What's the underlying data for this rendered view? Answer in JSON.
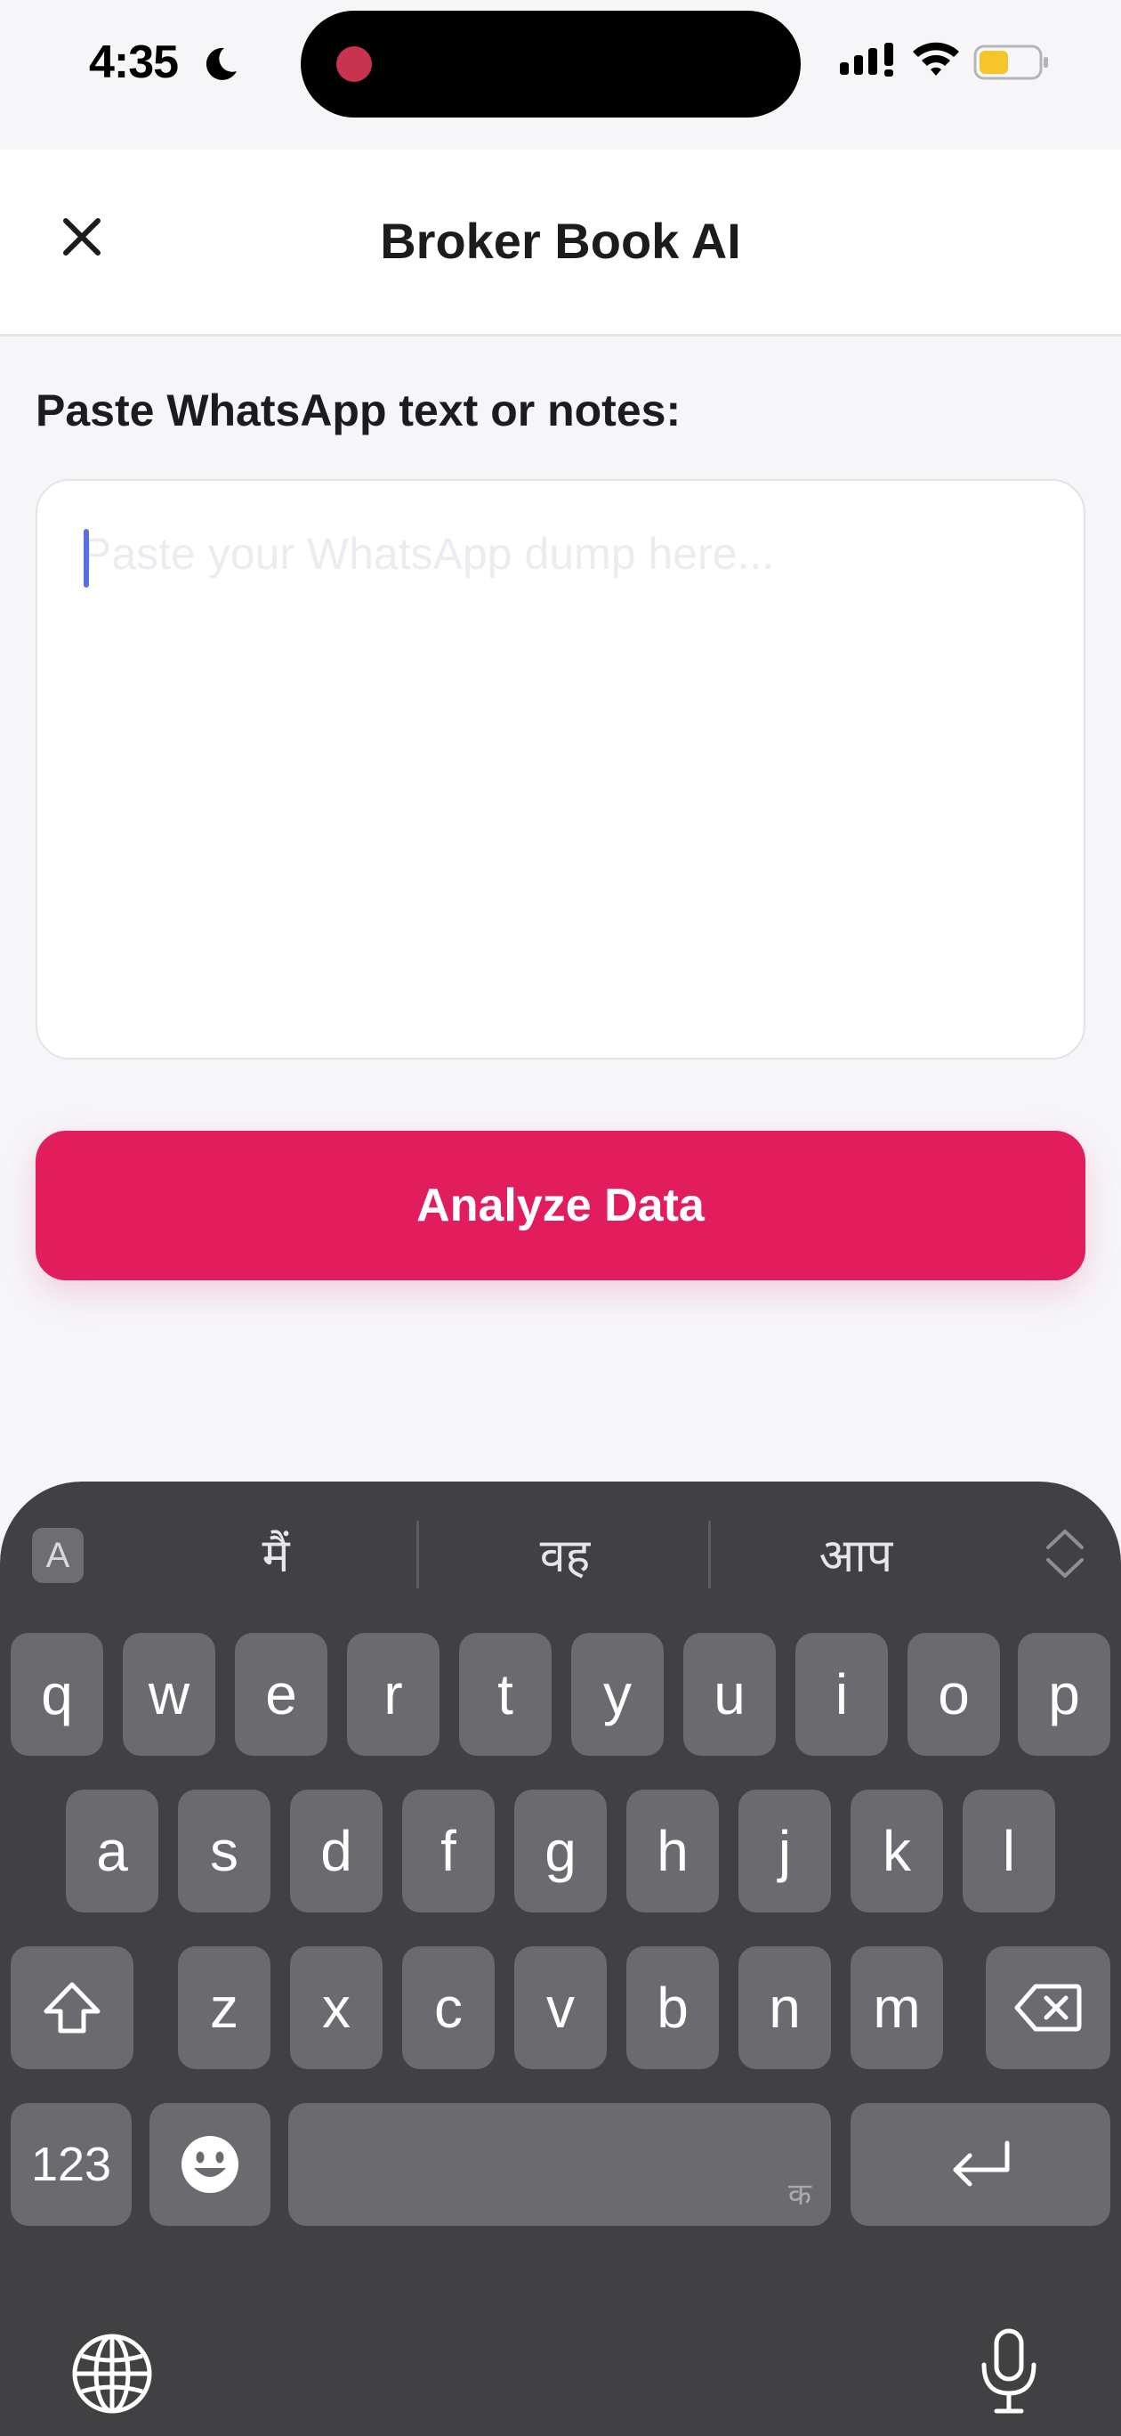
{
  "status_bar": {
    "time": "4:35"
  },
  "header": {
    "title": "Broker Book AI"
  },
  "form": {
    "label": "Paste WhatsApp text or notes:",
    "notes_value": "",
    "notes_placeholder": "Paste your WhatsApp dump here...",
    "analyze_label": "Analyze Data"
  },
  "colors": {
    "accent": "#e11d5e",
    "caret": "#5a6ee6",
    "keyboard_bg": "#414144",
    "key_bg": "#6b6b6f"
  },
  "keyboard": {
    "predictions": [
      "मैं",
      "वह",
      "आप"
    ],
    "toggle_label": "A",
    "row1": [
      "q",
      "w",
      "e",
      "r",
      "t",
      "y",
      "u",
      "i",
      "o",
      "p"
    ],
    "row2": [
      "a",
      "s",
      "d",
      "f",
      "g",
      "h",
      "j",
      "k",
      "l"
    ],
    "row3": [
      "z",
      "x",
      "c",
      "v",
      "b",
      "n",
      "m"
    ],
    "numbers_label": "123",
    "space_hint": "क",
    "icons": [
      "shift-icon",
      "backspace-icon",
      "emoji-icon",
      "return-icon",
      "globe-icon",
      "microphone-icon"
    ]
  }
}
